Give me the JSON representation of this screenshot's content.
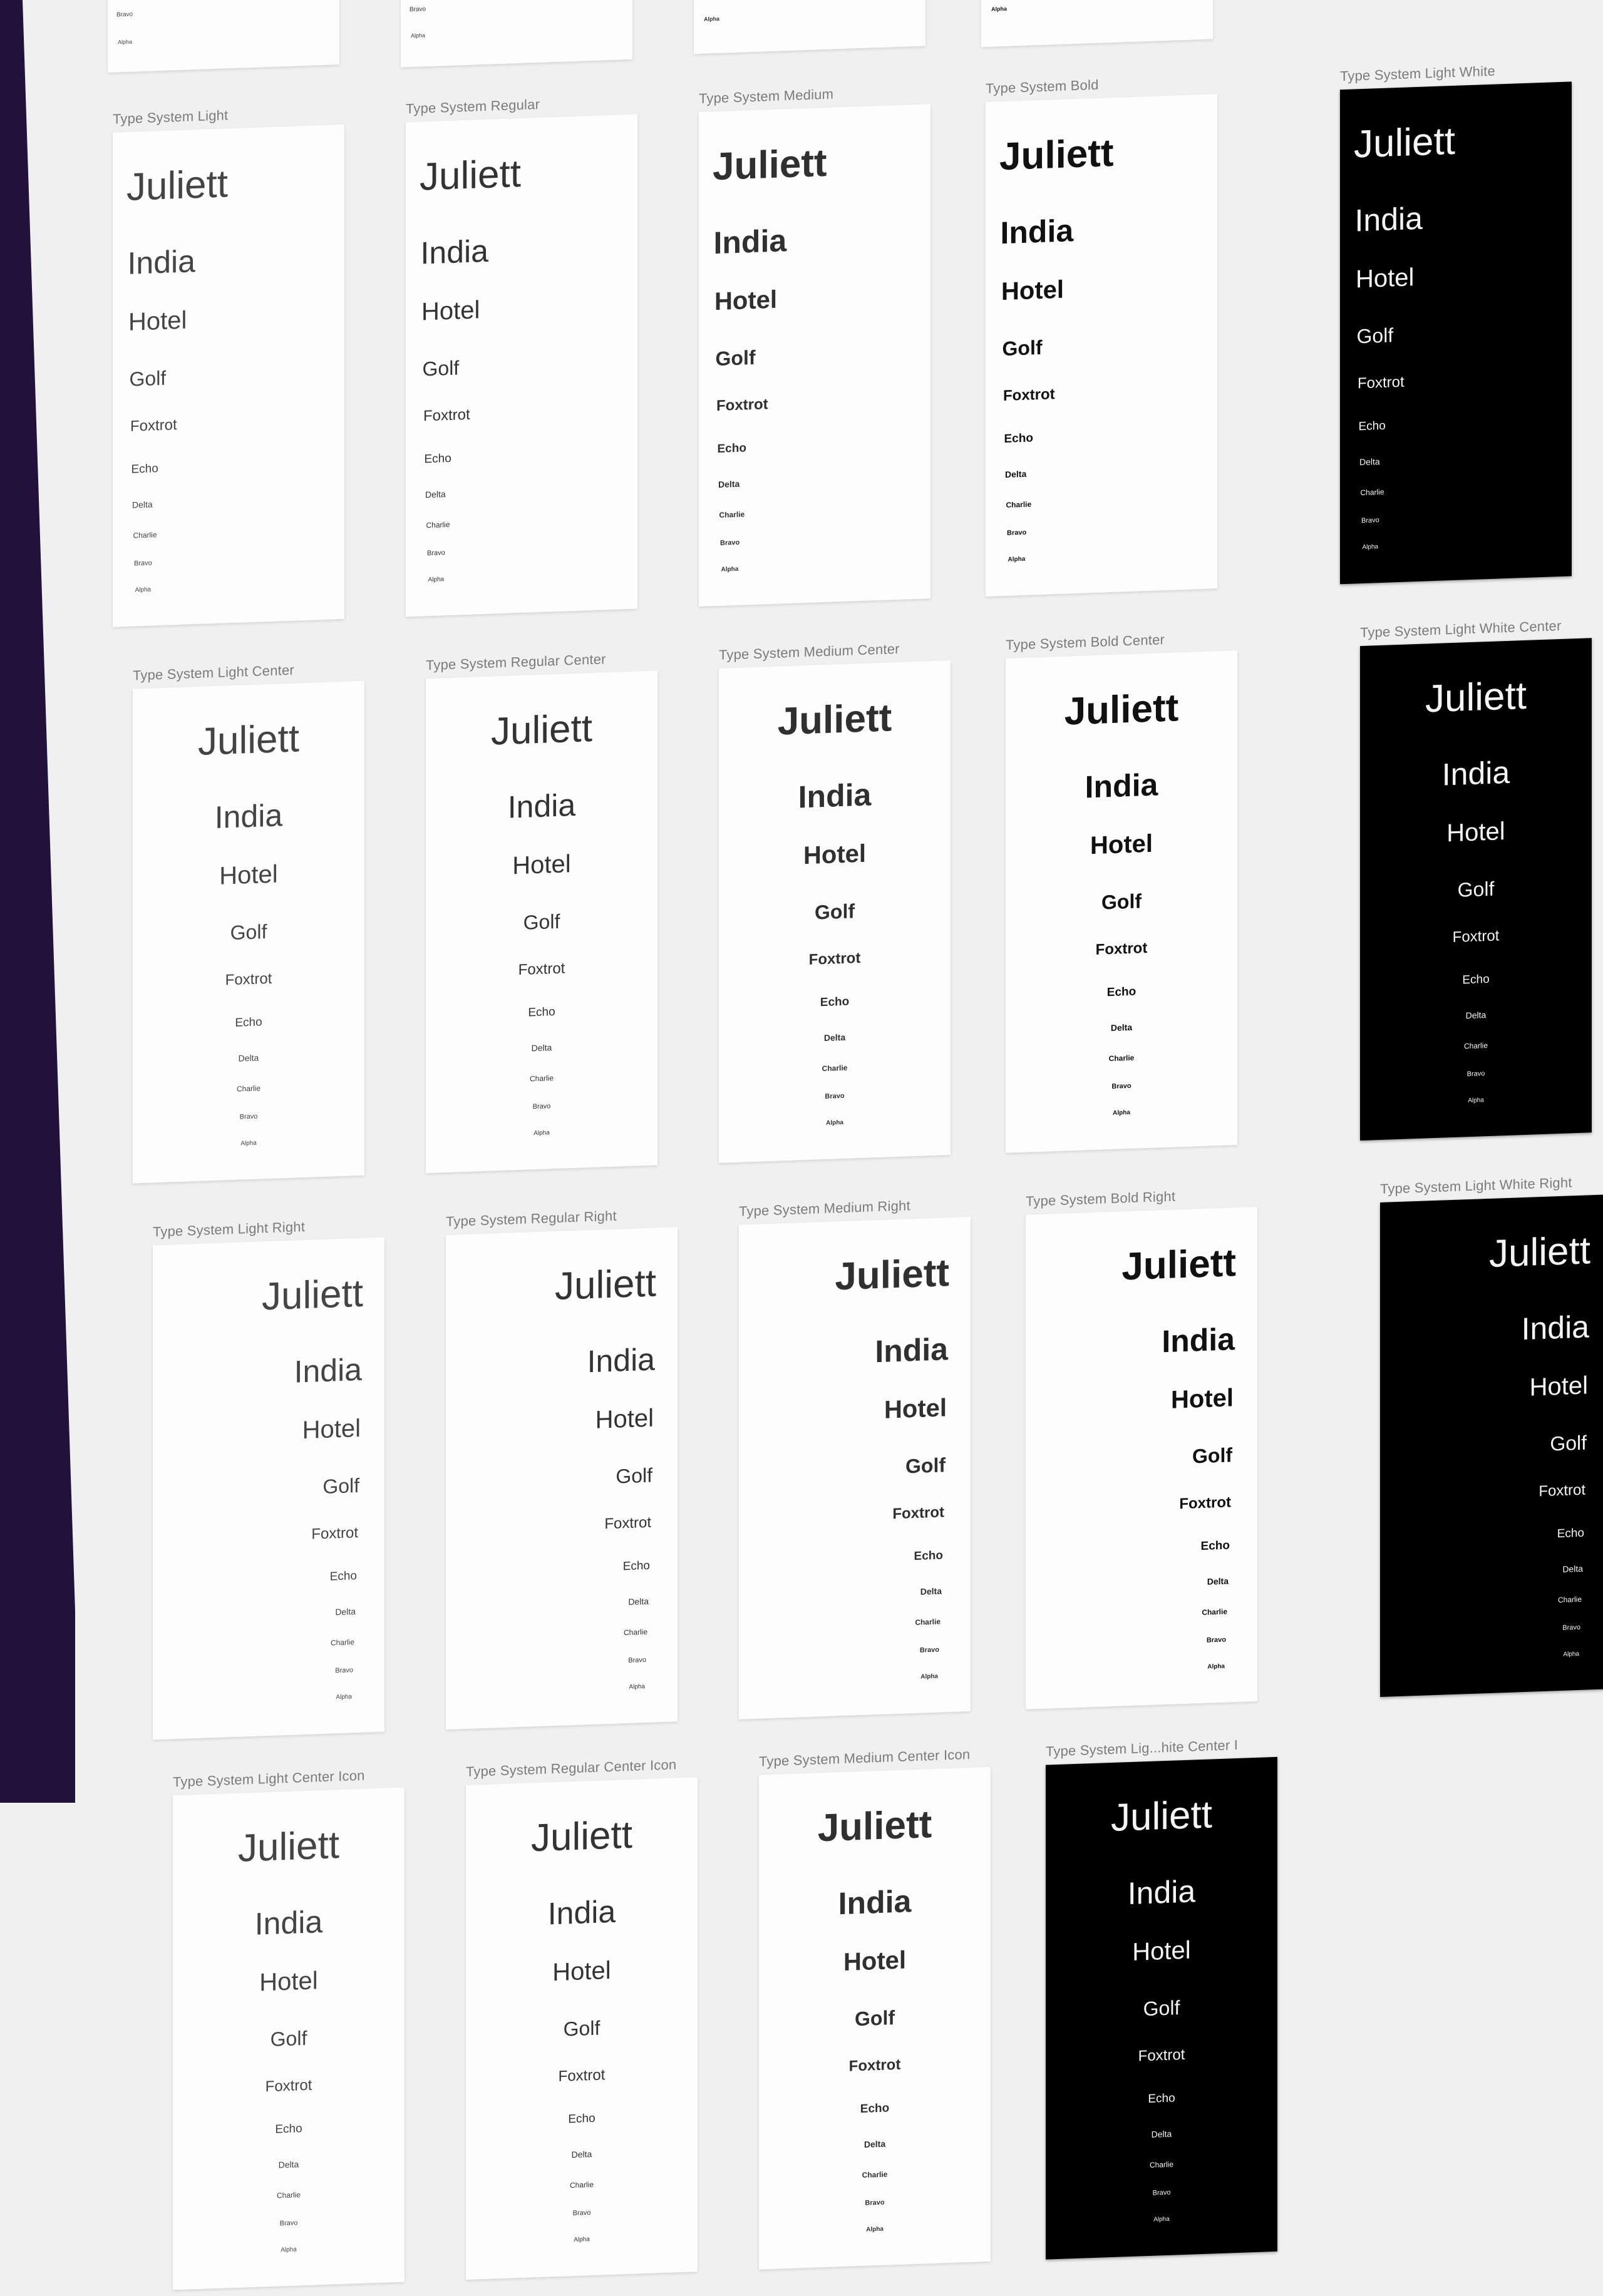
{
  "palette": {
    "canvas": "#f0f0f0",
    "edge_panel": "#22113a",
    "frame_white": "#fdfdfd",
    "frame_dark": "#000000",
    "label": "#7b7b7b"
  },
  "sample_words": [
    "Juliett",
    "India",
    "Hotel",
    "Golf",
    "Foxtrot",
    "Echo",
    "Delta",
    "Charlie",
    "Bravo",
    "Alpha"
  ],
  "frames": [
    {
      "label": "Type System Light",
      "variant": "light",
      "align": "left",
      "theme": "white"
    },
    {
      "label": "Type System Regular",
      "variant": "regular",
      "align": "left",
      "theme": "white"
    },
    {
      "label": "Type System Medium",
      "variant": "medium",
      "align": "left",
      "theme": "white"
    },
    {
      "label": "Type System Bold",
      "variant": "bold",
      "align": "left",
      "theme": "white"
    },
    {
      "label": "Type System Light White",
      "variant": "light",
      "align": "left",
      "theme": "dark"
    },
    {
      "label": "Type System Light Center",
      "variant": "light",
      "align": "center",
      "theme": "white"
    },
    {
      "label": "Type System Regular Center",
      "variant": "regular",
      "align": "center",
      "theme": "white"
    },
    {
      "label": "Type System Medium Center",
      "variant": "medium",
      "align": "center",
      "theme": "white"
    },
    {
      "label": "Type System Bold Center",
      "variant": "bold",
      "align": "center",
      "theme": "white"
    },
    {
      "label": "Type System Light White Center",
      "variant": "light",
      "align": "center",
      "theme": "dark"
    },
    {
      "label": "Type System Light Right",
      "variant": "light",
      "align": "right",
      "theme": "white"
    },
    {
      "label": "Type System Regular Right",
      "variant": "regular",
      "align": "right",
      "theme": "white"
    },
    {
      "label": "Type System Medium Right",
      "variant": "medium",
      "align": "right",
      "theme": "white"
    },
    {
      "label": "Type System Bold Right",
      "variant": "bold",
      "align": "right",
      "theme": "white"
    },
    {
      "label": "Type System Light White Right",
      "variant": "light",
      "align": "right",
      "theme": "dark"
    },
    {
      "label": "Type System Light Center Icon",
      "variant": "light",
      "align": "center",
      "theme": "white"
    },
    {
      "label": "Type System Regular Center Icon",
      "variant": "regular",
      "align": "center",
      "theme": "white"
    },
    {
      "label": "Type System Medium Center Icon",
      "variant": "medium",
      "align": "center",
      "theme": "white"
    },
    {
      "label": "Type System Lig...hite Center I",
      "variant": "light",
      "align": "center",
      "theme": "dark"
    }
  ],
  "top_partial_frames": [
    {
      "lines": [
        "Bravo",
        "Alpha"
      ]
    },
    {
      "lines": [
        "Bravo",
        "Alpha"
      ]
    },
    {
      "lines": [
        "Alpha"
      ]
    },
    {
      "lines": [
        "Alpha"
      ]
    }
  ]
}
